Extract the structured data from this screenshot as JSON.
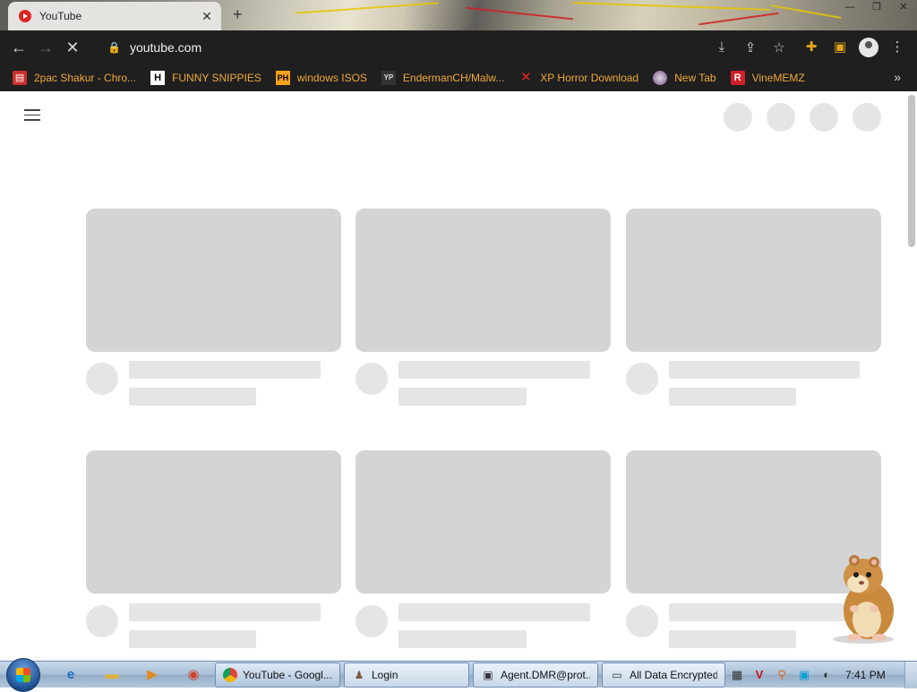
{
  "browser": {
    "tab": {
      "title": "YouTube",
      "favicon": "youtube-icon",
      "close": "✕"
    },
    "new_tab_symbol": "+",
    "window_controls": {
      "minimize": "—",
      "maximize": "❐",
      "close": "✕"
    },
    "toolbar": {
      "back": "←",
      "forward": "→",
      "reload": "✕",
      "lock": "🔒",
      "url": "youtube.com",
      "icons": [
        "install-icon",
        "share-icon",
        "star-icon",
        "extensions-icon",
        "sidepanel-icon",
        "profile-icon",
        "menu-icon"
      ]
    },
    "bookmarks": [
      {
        "label": "2pac Shakur - Chro...",
        "icon": "folder-icon"
      },
      {
        "label": "FUNNY SNIPPIES",
        "icon": "h-icon"
      },
      {
        "label": "windows ISOS",
        "icon": "ph-icon"
      },
      {
        "label": "EndermanCH/Malw...",
        "icon": "yp-icon"
      },
      {
        "label": "XP Horror Download",
        "icon": "x-icon"
      },
      {
        "label": "New Tab",
        "icon": "globe-icon"
      },
      {
        "label": "VineMEMZ",
        "icon": "r-icon"
      }
    ],
    "bookmarks_overflow": "»"
  },
  "page": {
    "loading": true,
    "skeleton_cards": 6
  },
  "taskbar": {
    "quick_launch": [
      "ie-icon",
      "explorer-icon",
      "media-player-icon",
      "firefox-icon"
    ],
    "buttons": [
      {
        "label": "YouTube - Googl...",
        "icon": "chrome-icon",
        "active": true
      },
      {
        "label": "Login",
        "icon": "app-icon",
        "active": false
      },
      {
        "label": "Agent.DMR@prot...",
        "icon": "window-icon",
        "active": false
      },
      {
        "label": "All Data Encrypted",
        "icon": "window-icon",
        "active": false
      }
    ],
    "tray_icons": [
      "network-icon",
      "v-icon",
      "search-tray-icon",
      "display-icon",
      "media-icon"
    ],
    "clock": "7:41 PM"
  }
}
